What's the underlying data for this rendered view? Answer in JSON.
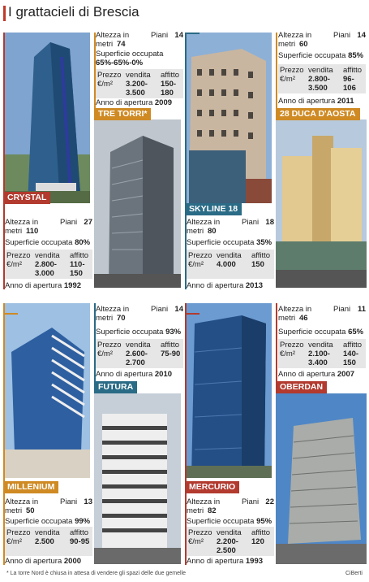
{
  "header": {
    "title": "I grattacieli di Brescia"
  },
  "labels": {
    "altezza": "Altezza in metri",
    "piani": "Piani",
    "superficie": "Superficie occupata",
    "prezzo": "Prezzo €/m²",
    "vendita": "vendita",
    "affitto": "affitto",
    "anno": "Anno di apertura"
  },
  "buildings": [
    {
      "name": "CRYSTAL",
      "altezza": "110",
      "piani": "27",
      "superficie": "80%",
      "vendita": "2.800-3.000",
      "affitto": "110-150",
      "anno": "1992"
    },
    {
      "name": "TRE TORRI*",
      "altezza": "74",
      "piani": "14",
      "superficie": "65%-65%-0%",
      "vendita": "3.200-3.500",
      "affitto": "150-180",
      "anno": "2009"
    },
    {
      "name": "SKYLINE 18",
      "altezza": "80",
      "piani": "18",
      "superficie": "35%",
      "vendita": "4.000",
      "affitto": "150",
      "anno": "2013"
    },
    {
      "name": "28 DUCA D'AOSTA",
      "altezza": "60",
      "piani": "14",
      "superficie": "85%",
      "vendita": "2.800-3.500",
      "affitto": "96-106",
      "anno": "2011"
    },
    {
      "name": "MILLENIUM",
      "altezza": "50",
      "piani": "13",
      "superficie": "99%",
      "vendita": "2.500",
      "affitto": "90-95",
      "anno": "2000"
    },
    {
      "name": "FUTURA",
      "altezza": "70",
      "piani": "14",
      "superficie": "93%",
      "vendita": "2.600-2.700",
      "affitto": "75-90",
      "anno": "2010"
    },
    {
      "name": "MERCURIO",
      "altezza": "82",
      "piani": "22",
      "superficie": "95%",
      "vendita": "2.200-2.500",
      "affitto": "120",
      "anno": "1993"
    },
    {
      "name": "OBERDAN",
      "altezza": "46",
      "piani": "11",
      "superficie": "65%",
      "vendita": "2.100-3.400",
      "affitto": "140-150",
      "anno": "2007"
    }
  ],
  "footnote": "* La torre Nord è chiusa in attesa di vendere gli spazi delle due gemelle",
  "credit": "CiBerti",
  "colors": {
    "red": "#b23a2e",
    "teal": "#2a6b86",
    "orange": "#cf8a24"
  }
}
